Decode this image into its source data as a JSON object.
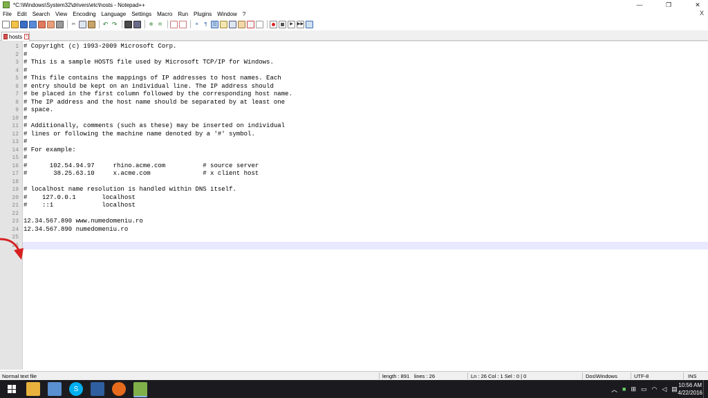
{
  "window": {
    "title": "*C:\\Windows\\System32\\drivers\\etc\\hosts - Notepad++",
    "minimize": "—",
    "maximize": "❐",
    "close": "✕"
  },
  "menu": {
    "items": [
      "File",
      "Edit",
      "Search",
      "View",
      "Encoding",
      "Language",
      "Settings",
      "Macro",
      "Run",
      "Plugins",
      "Window",
      "?"
    ],
    "close_doc": "X"
  },
  "tab": {
    "label": "hosts",
    "close": "×"
  },
  "editor": {
    "current_line": 26,
    "lines": [
      "# Copyright (c) 1993-2009 Microsoft Corp.",
      "#",
      "# This is a sample HOSTS file used by Microsoft TCP/IP for Windows.",
      "#",
      "# This file contains the mappings of IP addresses to host names. Each",
      "# entry should be kept on an individual line. The IP address should",
      "# be placed in the first column followed by the corresponding host name.",
      "# The IP address and the host name should be separated by at least one",
      "# space.",
      "#",
      "# Additionally, comments (such as these) may be inserted on individual",
      "# lines or following the machine name denoted by a '#' symbol.",
      "#",
      "# For example:",
      "#",
      "#      102.54.94.97     rhino.acme.com          # source server",
      "#       38.25.63.10     x.acme.com              # x client host",
      "",
      "# localhost name resolution is handled within DNS itself.",
      "#    127.0.0.1       localhost",
      "#    ::1             localhost",
      "",
      "12.34.567.890 www.numedomeniu.ro",
      "12.34.567.890 numedomeniu.ro",
      "",
      ""
    ]
  },
  "status": {
    "file_type": "Normal text file",
    "length": "length : 891",
    "lines": "lines : 26",
    "position": "Ln : 26   Col : 1   Sel : 0 | 0",
    "eol": "Dos\\Windows",
    "encoding": "UTF-8",
    "mode": "INS"
  },
  "taskbar": {
    "time": "10:56 AM",
    "date": "4/22/2016"
  },
  "colors": {
    "gutter": "#e4e4e4",
    "current_line": "#e8e8ff",
    "arrow": "#d62020",
    "taskbar": "#1b1b1f"
  }
}
